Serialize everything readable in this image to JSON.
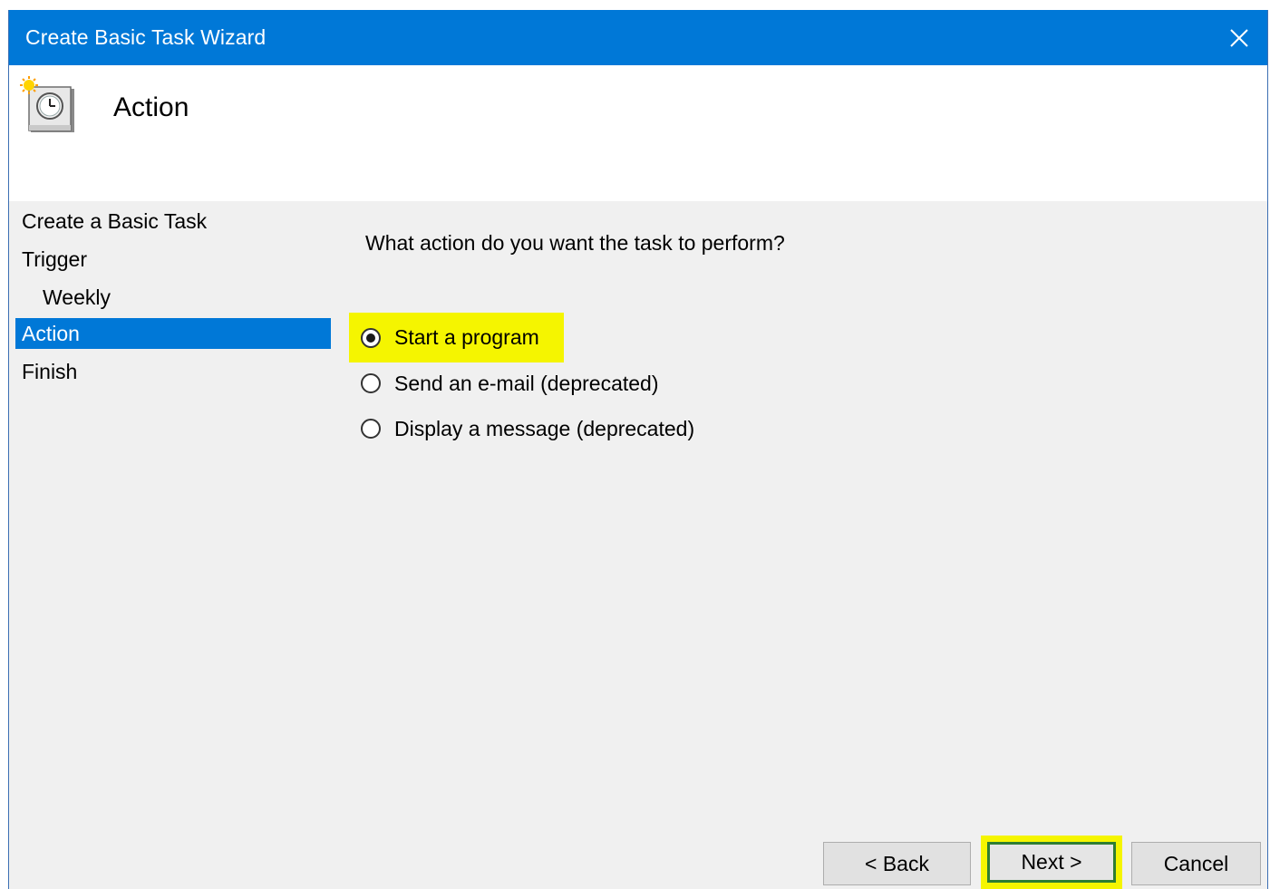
{
  "window": {
    "title": "Create Basic Task Wizard",
    "close_glyph": "✕"
  },
  "header": {
    "title": "Action",
    "icon": "scheduled-task-clock-icon"
  },
  "nav": {
    "items": [
      {
        "label": "Create a Basic Task",
        "active": false,
        "indent": false
      },
      {
        "label": "Trigger",
        "active": false,
        "indent": false
      },
      {
        "label": "Weekly",
        "active": false,
        "indent": true
      },
      {
        "label": "Action",
        "active": true,
        "indent": false
      },
      {
        "label": "Finish",
        "active": false,
        "indent": false
      }
    ]
  },
  "main": {
    "question": "What action do you want the task to perform?",
    "options": [
      {
        "label": "Start a program",
        "selected": true
      },
      {
        "label": "Send an e-mail (deprecated)",
        "selected": false
      },
      {
        "label": "Display a message (deprecated)",
        "selected": false
      }
    ]
  },
  "buttons": {
    "back": "< Back",
    "next": "Next >",
    "cancel": "Cancel"
  },
  "colors": {
    "titlebar": "#0078d7",
    "active_nav": "#0078d7",
    "highlight": "#f5f500",
    "next_border": "#2e7d32"
  }
}
